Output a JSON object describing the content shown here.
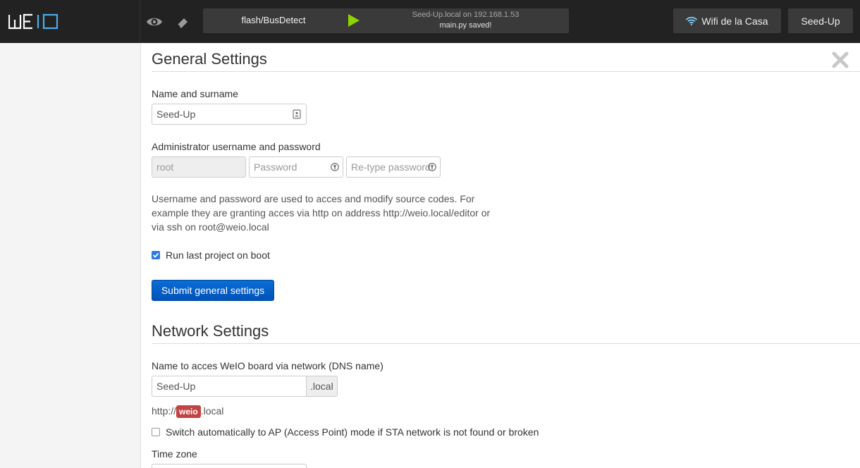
{
  "topbar": {
    "logo_text": "WEIO",
    "project_name": "flash/BusDetect",
    "status_host": "Seed-Up.local on 192.168.1.53",
    "status_message": "main.py saved!",
    "wifi_label": "Wifi de la Casa",
    "user_label": "Seed-Up",
    "icons": [
      "eye-icon",
      "eraser-icon",
      "play-icon",
      "wifi-icon"
    ]
  },
  "general": {
    "title": "General Settings",
    "name_label": "Name and surname",
    "name_value": "Seed-Up",
    "admin_label": "Administrator username and password",
    "username_value": "root",
    "password_placeholder": "Password",
    "retype_placeholder": "Re-type password",
    "help_text": "Username and password are used to acces and modify source codes. For example they are granting acces via http on address http://weio.local/editor or via ssh on root@weio.local",
    "run_on_boot_label": "Run last project on boot",
    "run_on_boot_checked": true,
    "submit_label": "Submit general settings"
  },
  "network": {
    "title": "Network Settings",
    "dns_label": "Name to acces WeIO board via network (DNS name)",
    "dns_value": "Seed-Up",
    "dns_suffix": ".local",
    "url_prefix": "http://",
    "url_badge": "weio",
    "url_suffix": ".local",
    "ap_switch_label": "Switch automatically to AP (Access Point) mode if STA network is not found or broken",
    "ap_switch_checked": false,
    "timezone_label": "Time zone"
  },
  "colors": {
    "topbar_bg": "#222222",
    "accent_play": "#8fd400",
    "primary_button": "#0a6ed6",
    "badge_red": "#c34343"
  }
}
